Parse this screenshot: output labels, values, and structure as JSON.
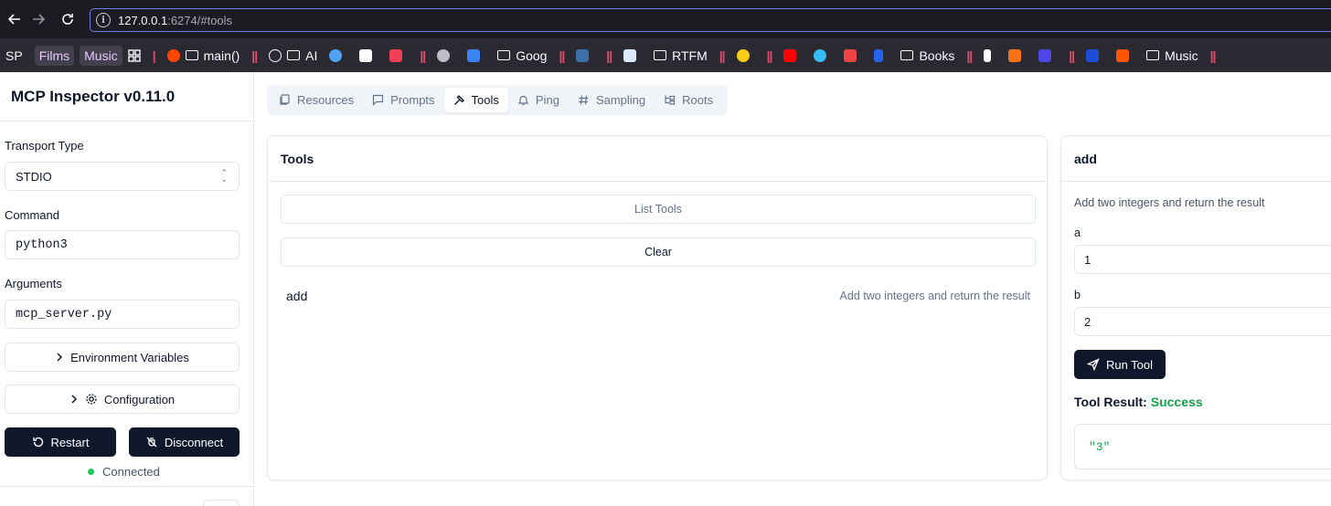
{
  "browser": {
    "url_host": "127.0.0.1",
    "url_rest": ":6274/#tools",
    "bookmarks": {
      "sp": "SP",
      "films": "Films",
      "music": "Music",
      "main": "main()",
      "ai": "AI",
      "goog": "Goog",
      "rtfm": "RTFM",
      "books": "Books",
      "music2": "Music"
    }
  },
  "sidebar": {
    "title": "MCP Inspector v0.11.0",
    "transport_label": "Transport Type",
    "transport_value": "STDIO",
    "command_label": "Command",
    "command_value": "python3",
    "arguments_label": "Arguments",
    "arguments_value": "mcp_server.py",
    "env_button": "Environment Variables",
    "config_button": "Configuration",
    "restart_button": "Restart",
    "disconnect_button": "Disconnect",
    "status": "Connected",
    "status_color": "#22c55e"
  },
  "tabs": [
    {
      "label": "Resources"
    },
    {
      "label": "Prompts"
    },
    {
      "label": "Tools"
    },
    {
      "label": "Ping"
    },
    {
      "label": "Sampling"
    },
    {
      "label": "Roots"
    }
  ],
  "tools_panel": {
    "title": "Tools",
    "list_button": "List Tools",
    "clear_button": "Clear",
    "tools": [
      {
        "name": "add",
        "description": "Add two integers and return the result"
      }
    ]
  },
  "tool_detail": {
    "title": "add",
    "description": "Add two integers and return the result",
    "param_a_label": "a",
    "param_a_value": "1",
    "param_b_label": "b",
    "param_b_value": "2",
    "run_button": "Run Tool",
    "result_label": "Tool Result:",
    "result_status": "Success",
    "result_value": "\"3\"",
    "accent_color": "#16a34a"
  }
}
